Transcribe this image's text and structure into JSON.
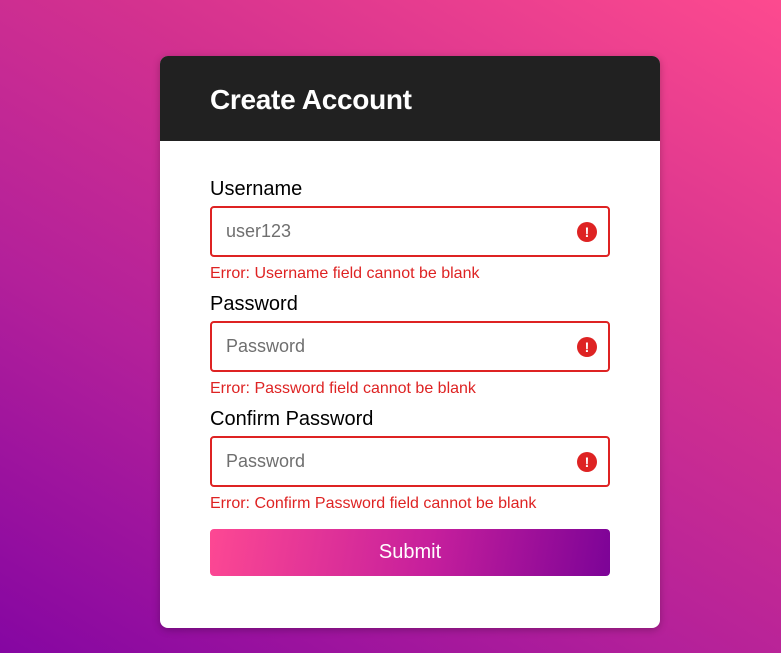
{
  "form": {
    "title": "Create Account",
    "fields": [
      {
        "label": "Username",
        "value": "",
        "placeholder": "user123",
        "error": "Error: Username field cannot be blank"
      },
      {
        "label": "Password",
        "value": "",
        "placeholder": "Password",
        "error": "Error: Password field cannot be blank"
      },
      {
        "label": "Confirm Password",
        "value": "",
        "placeholder": "Password",
        "error": "Error: Confirm Password field cannot be blank"
      }
    ],
    "error_icon_glyph": "!",
    "submit_label": "Submit"
  },
  "colors": {
    "header_bg": "#212121",
    "error": "#de2323",
    "gradient_start": "#fd4893",
    "gradient_end": "#7c0397"
  },
  "icons": {
    "error": "exclamation-circle-icon"
  }
}
